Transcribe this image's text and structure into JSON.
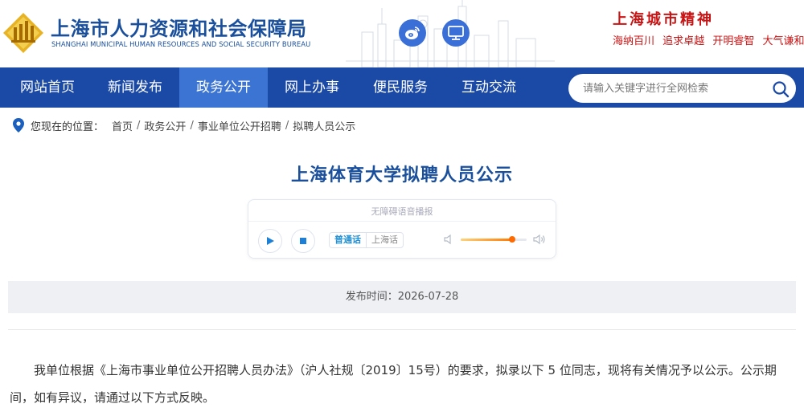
{
  "header": {
    "title_cn": "上海市人力资源和社会保障局",
    "title_en": "SHANGHAI MUNICIPAL HUMAN RESOURCES AND SOCIAL SECURITY BUREAU",
    "spirit_title": "上海城市精神",
    "spirit_words": [
      "海纳百川",
      "追求卓越",
      "开明睿智",
      "大气谦和"
    ],
    "icons": [
      "weibo-icon",
      "computer-icon"
    ]
  },
  "nav": {
    "items": [
      "网站首页",
      "新闻发布",
      "政务公开",
      "网上办事",
      "便民服务",
      "互动交流"
    ],
    "active_index": 2
  },
  "search": {
    "placeholder": "请输入关键字进行全网检索"
  },
  "breadcrumb": {
    "label": "您现在的位置：",
    "items": [
      "首页",
      "政务公开",
      "事业单位公开招聘",
      "拟聘人员公示"
    ]
  },
  "article": {
    "title": "上海体育大学拟聘人员公示",
    "publish_label": "发布时间：",
    "publish_date": "2026-07-28",
    "body": "我单位根据《上海市事业单位公开招聘人员办法》（沪人社规〔2019〕15号）的要求，拟录以下 5 位同志，现将有关情况予以公示。公示期间，如有异议，请通过以下方式反映。"
  },
  "player": {
    "caption": "无障碍语音播报",
    "lang_mandarin": "普通话",
    "lang_shanghai": "上海话",
    "volume_fraction": 0.78
  },
  "colors": {
    "brand_blue": "#1b4aa6",
    "nav_active": "#3b74d2",
    "title_blue": "#1a4f9c",
    "spirit_red": "#c81414",
    "volume_orange": "#ff6a00"
  }
}
